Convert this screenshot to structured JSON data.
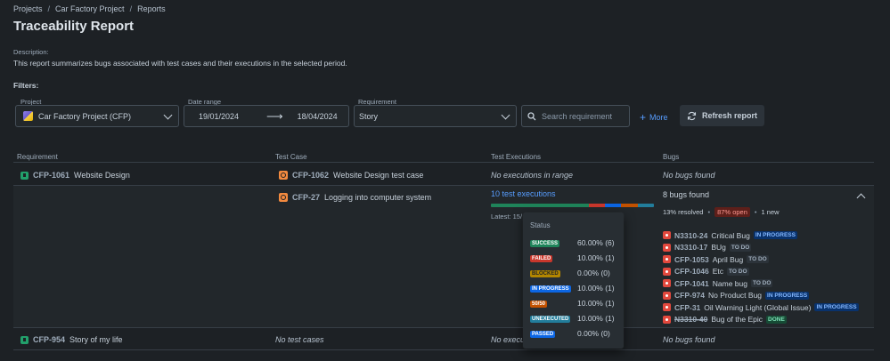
{
  "breadcrumb": [
    "Projects",
    "Car Factory Project",
    "Reports"
  ],
  "title": "Traceability Report",
  "description": {
    "label": "Description:",
    "text": "This report summarizes bugs associated with test cases and their executions in the selected period."
  },
  "filters": {
    "label": "Filters:",
    "project": {
      "label": "Project",
      "value": "Car Factory Project (CFP)"
    },
    "date_range": {
      "label": "Date range",
      "from": "19/01/2024",
      "to": "18/04/2024"
    },
    "requirement": {
      "label": "Requirement",
      "value": "Story"
    },
    "search": {
      "placeholder": "Search requirement"
    },
    "more_label": "More",
    "refresh_label": "Refresh report"
  },
  "columns": [
    "Requirement",
    "Test Case",
    "Test Executions",
    "Bugs"
  ],
  "rows": [
    {
      "req_key": "CFP-1061",
      "req_title": "Website Design",
      "tc_key": "CFP-1062",
      "tc_title": "Website Design test case",
      "executions": "No executions in range",
      "bugs": "No bugs found"
    },
    {
      "tc_key": "CFP-27",
      "tc_title": "Logging into computer system",
      "executions_link": "10 test executions",
      "latest": "Latest: 15/",
      "bugs_found": "8 bugs found",
      "resolved": "13% resolved",
      "open": "87% open",
      "new": "1 new",
      "bug_list": [
        {
          "key": "N3310-24",
          "title": "Critical Bug",
          "status": "IN PROGRESS"
        },
        {
          "key": "N3310-17",
          "title": "BUg",
          "status": "TO DO"
        },
        {
          "key": "CFP-1053",
          "title": "April Bug",
          "status": "TO DO"
        },
        {
          "key": "CFP-1046",
          "title": "Etc",
          "status": "TO DO"
        },
        {
          "key": "CFP-1041",
          "title": "Name bug",
          "status": "TO DO"
        },
        {
          "key": "CFP-974",
          "title": "No Product Bug",
          "status": "IN PROGRESS"
        },
        {
          "key": "CFP-31",
          "title": "Oil Warning Light (Global Issue)",
          "status": "IN PROGRESS"
        },
        {
          "key": "N3310-40",
          "title": "Bug of the Epic",
          "status": "DONE"
        }
      ]
    },
    {
      "req_key": "CFP-954",
      "req_title": "Story of my life",
      "tc_none": "No test cases",
      "executions": "No execu",
      "bugs": "No bugs found"
    }
  ],
  "status_popup": {
    "title": "Status",
    "items": [
      {
        "label": "SUCCESS",
        "value": "60.00% (6)"
      },
      {
        "label": "FAILED",
        "value": "10.00% (1)"
      },
      {
        "label": "BLOCKED",
        "value": "0.00% (0)"
      },
      {
        "label": "IN PROGRESS",
        "value": "10.00% (1)"
      },
      {
        "label": "50/50",
        "value": "10.00% (1)"
      },
      {
        "label": "UNEXECUTED",
        "value": "10.00% (1)"
      },
      {
        "label": "PASSED",
        "value": "0.00% (0)"
      }
    ]
  },
  "progress_fractions": [
    0.6,
    0.1,
    0.1,
    0.1,
    0.1
  ],
  "progress_colors": [
    "#1f845a",
    "#c9372c",
    "#0c66e4",
    "#c25100",
    "#227d9b"
  ]
}
